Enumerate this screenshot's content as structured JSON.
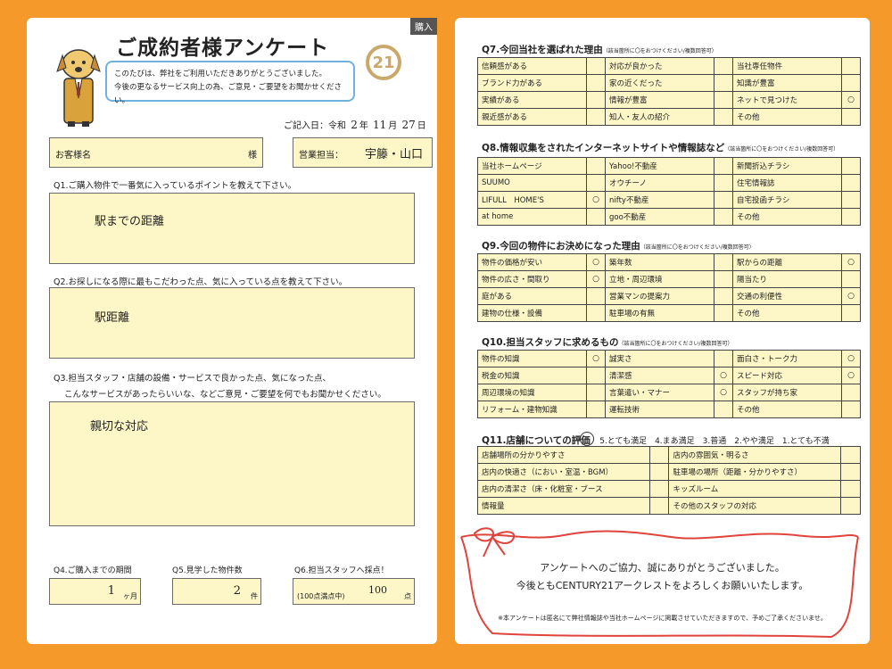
{
  "header": {
    "tag": "購入",
    "title": "ご成約者様アンケート",
    "intro_line1": "このたびは、弊社をご利用いただきありがとうございました。",
    "intro_line2": "今後の更なるサービス向上の為、ご意見・ご要望をお聞かせください。",
    "logo_text": "21"
  },
  "date": {
    "label": "ご記入日：令和",
    "year": "2",
    "year_unit": "年",
    "month": "11",
    "month_unit": "月",
    "day": "27",
    "day_unit": "日"
  },
  "customer": {
    "label": "お客様名",
    "suffix": "様",
    "staff_label": "営業担当：",
    "staff_value": "宇籐・山口"
  },
  "q1": {
    "title": "Q1.ご購入物件で一番気に入っているポイントを教えて下さい。",
    "answer": "駅までの距離"
  },
  "q2": {
    "title": "Q2.お探しになる際に最もこだわった点、気に入っている点を教えて下さい。",
    "answer": "駅距離"
  },
  "q3": {
    "title_line1": "Q3.担当スタッフ・店舗の設備・サービスで良かった点、気になった点、",
    "title_line2": "こんなサービスがあったらいいな、などご意見・ご要望を何でもお聞かせください。",
    "answer": "親切な対応"
  },
  "q4": {
    "title": "Q4.ご購入までの期間",
    "value": "1",
    "unit": "ヶ月"
  },
  "q5": {
    "title": "Q5.見学した物件数",
    "value": "2",
    "unit": "件"
  },
  "q6": {
    "title": "Q6.担当スタッフへ採点！",
    "prefix": "(100点満点中)",
    "value": "100",
    "unit": "点"
  },
  "q7": {
    "title": "Q7.今回当社を選ばれた理由",
    "note": "（該当箇所に〇をおつけください/複数回答可）",
    "rows": [
      [
        {
          "t": "信頼感がある",
          "m": ""
        },
        {
          "t": "対応が良かった",
          "m": ""
        },
        {
          "t": "当社専任物件",
          "m": ""
        }
      ],
      [
        {
          "t": "ブランド力がある",
          "m": ""
        },
        {
          "t": "家の近くだった",
          "m": ""
        },
        {
          "t": "知識が豊富",
          "m": ""
        }
      ],
      [
        {
          "t": "実績がある",
          "m": ""
        },
        {
          "t": "情報が豊富",
          "m": ""
        },
        {
          "t": "ネットで見つけた",
          "m": "○"
        }
      ],
      [
        {
          "t": "親近感がある",
          "m": ""
        },
        {
          "t": "知人・友人の紹介",
          "m": ""
        },
        {
          "t": "その他",
          "m": ""
        }
      ]
    ]
  },
  "q8": {
    "title": "Q8.情報収集をされたインターネットサイトや情報誌など",
    "note": "（該当箇所に〇をおつけください/複数回答可）",
    "rows": [
      [
        {
          "t": "当社ホームページ",
          "m": ""
        },
        {
          "t": "Yahoo!不動産",
          "m": ""
        },
        {
          "t": "新聞折込チラシ",
          "m": ""
        }
      ],
      [
        {
          "t": "SUUMO",
          "m": ""
        },
        {
          "t": "オウチーノ",
          "m": ""
        },
        {
          "t": "住宅情報誌",
          "m": ""
        }
      ],
      [
        {
          "t": "LIFULL　HOME'S",
          "m": "○"
        },
        {
          "t": "nifty不動産",
          "m": ""
        },
        {
          "t": "自宅投函チラシ",
          "m": ""
        }
      ],
      [
        {
          "t": "at home",
          "m": ""
        },
        {
          "t": "goo不動産",
          "m": ""
        },
        {
          "t": "その他",
          "m": ""
        }
      ]
    ]
  },
  "q9": {
    "title": "Q9.今回の物件にお決めになった理由",
    "note": "（該当箇所に〇をおつけください/複数回答可）",
    "rows": [
      [
        {
          "t": "物件の価格が安い",
          "m": "○"
        },
        {
          "t": "築年数",
          "m": ""
        },
        {
          "t": "駅からの距離",
          "m": "○"
        }
      ],
      [
        {
          "t": "物件の広さ・間取り",
          "m": "○"
        },
        {
          "t": "立地・周辺環境",
          "m": ""
        },
        {
          "t": "陽当たり",
          "m": ""
        }
      ],
      [
        {
          "t": "庭がある",
          "m": ""
        },
        {
          "t": "営業マンの提案力",
          "m": ""
        },
        {
          "t": "交通の利便性",
          "m": "○"
        }
      ],
      [
        {
          "t": "建物の仕様・設備",
          "m": ""
        },
        {
          "t": "駐車場の有無",
          "m": ""
        },
        {
          "t": "その他",
          "m": ""
        }
      ]
    ]
  },
  "q10": {
    "title": "Q10.担当スタッフに求めるもの",
    "note": "（該当箇所に〇をおつけください/複数回答可）",
    "rows": [
      [
        {
          "t": "物件の知識",
          "m": "○"
        },
        {
          "t": "誠実さ",
          "m": ""
        },
        {
          "t": "面白さ・トーク力",
          "m": "○"
        }
      ],
      [
        {
          "t": "税金の知識",
          "m": ""
        },
        {
          "t": "清潔感",
          "m": "○"
        },
        {
          "t": "スピード対応",
          "m": "○"
        }
      ],
      [
        {
          "t": "周辺環境の知識",
          "m": ""
        },
        {
          "t": "言葉遣い・マナー",
          "m": "○"
        },
        {
          "t": "スタッフが持ち家",
          "m": ""
        }
      ],
      [
        {
          "t": "リフォーム・建物知識",
          "m": ""
        },
        {
          "t": "運転技術",
          "m": ""
        },
        {
          "t": "その他",
          "m": ""
        }
      ]
    ]
  },
  "q11": {
    "title": "Q11.店舗についての評価",
    "scale": "5.とても満足　4.まあ満足　3.普通　2.やや満足　1.とても不満",
    "circled": "5",
    "rows": [
      [
        {
          "t": "店舗場所の分かりやすさ"
        },
        {
          "t": "店内の雰囲気・明るさ"
        }
      ],
      [
        {
          "t": "店内の快適さ（におい・室温・BGM）"
        },
        {
          "t": "駐車場の場所（距離・分かりやすさ）"
        }
      ],
      [
        {
          "t": "店内の清潔さ（床・化粧室・ブース"
        },
        {
          "t": "キッズルーム"
        }
      ],
      [
        {
          "t": "情報量"
        },
        {
          "t": "その他のスタッフの対応"
        }
      ]
    ]
  },
  "footer": {
    "thanks1": "アンケートへのご協力、誠にありがとうございました。",
    "thanks2": "今後ともCENTURY21アークレストをよろしくお願いいたします。",
    "note": "※本アンケートは匿名にて弊社情報誌や当社ホームページに掲載させていただきますので、予めご了承くださいませ。"
  },
  "colors": {
    "frame": "#f59a2a",
    "field": "#fdf6c6",
    "ribbon": "#e0443c",
    "bubble": "#6fb2de",
    "logo": "#c9a86a"
  }
}
